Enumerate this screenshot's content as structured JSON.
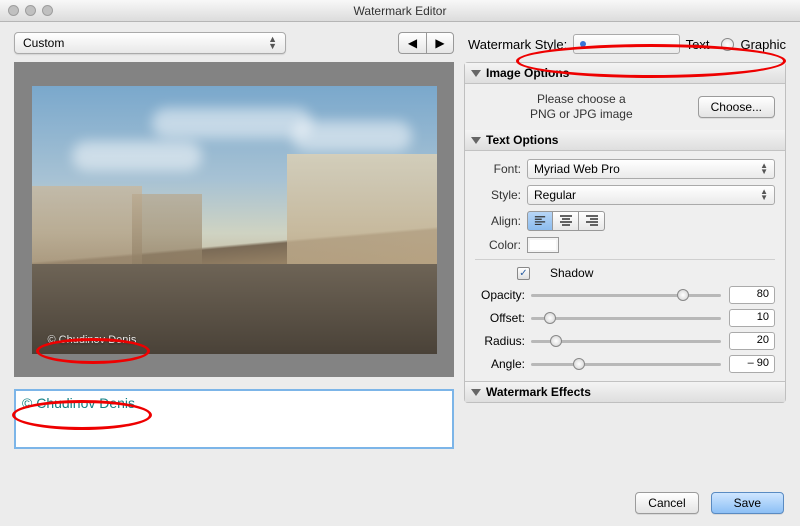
{
  "window": {
    "title": "Watermark Editor"
  },
  "preset": {
    "selected": "Custom"
  },
  "watermark_text": "© Chudinov Denis",
  "watermark_on_image": "© Chudinov Denis",
  "style": {
    "label": "Watermark Style:",
    "text_label": "Text",
    "graphic_label": "Graphic",
    "selected": "text"
  },
  "sections": {
    "image_options": {
      "title": "Image Options",
      "hint_line1": "Please choose a",
      "hint_line2": "PNG or JPG image",
      "choose_btn": "Choose..."
    },
    "text_options": {
      "title": "Text Options",
      "font_label": "Font:",
      "font_value": "Myriad Web Pro",
      "style_label": "Style:",
      "style_value": "Regular",
      "align_label": "Align:",
      "color_label": "Color:",
      "color_value": "#ffffff",
      "shadow": {
        "enabled": true,
        "label": "Shadow",
        "opacity_label": "Opacity:",
        "opacity_value": "80",
        "offset_label": "Offset:",
        "offset_value": "10",
        "radius_label": "Radius:",
        "radius_value": "20",
        "angle_label": "Angle:",
        "angle_value": "– 90"
      }
    },
    "watermark_effects": {
      "title": "Watermark Effects"
    }
  },
  "footer": {
    "cancel": "Cancel",
    "save": "Save"
  }
}
